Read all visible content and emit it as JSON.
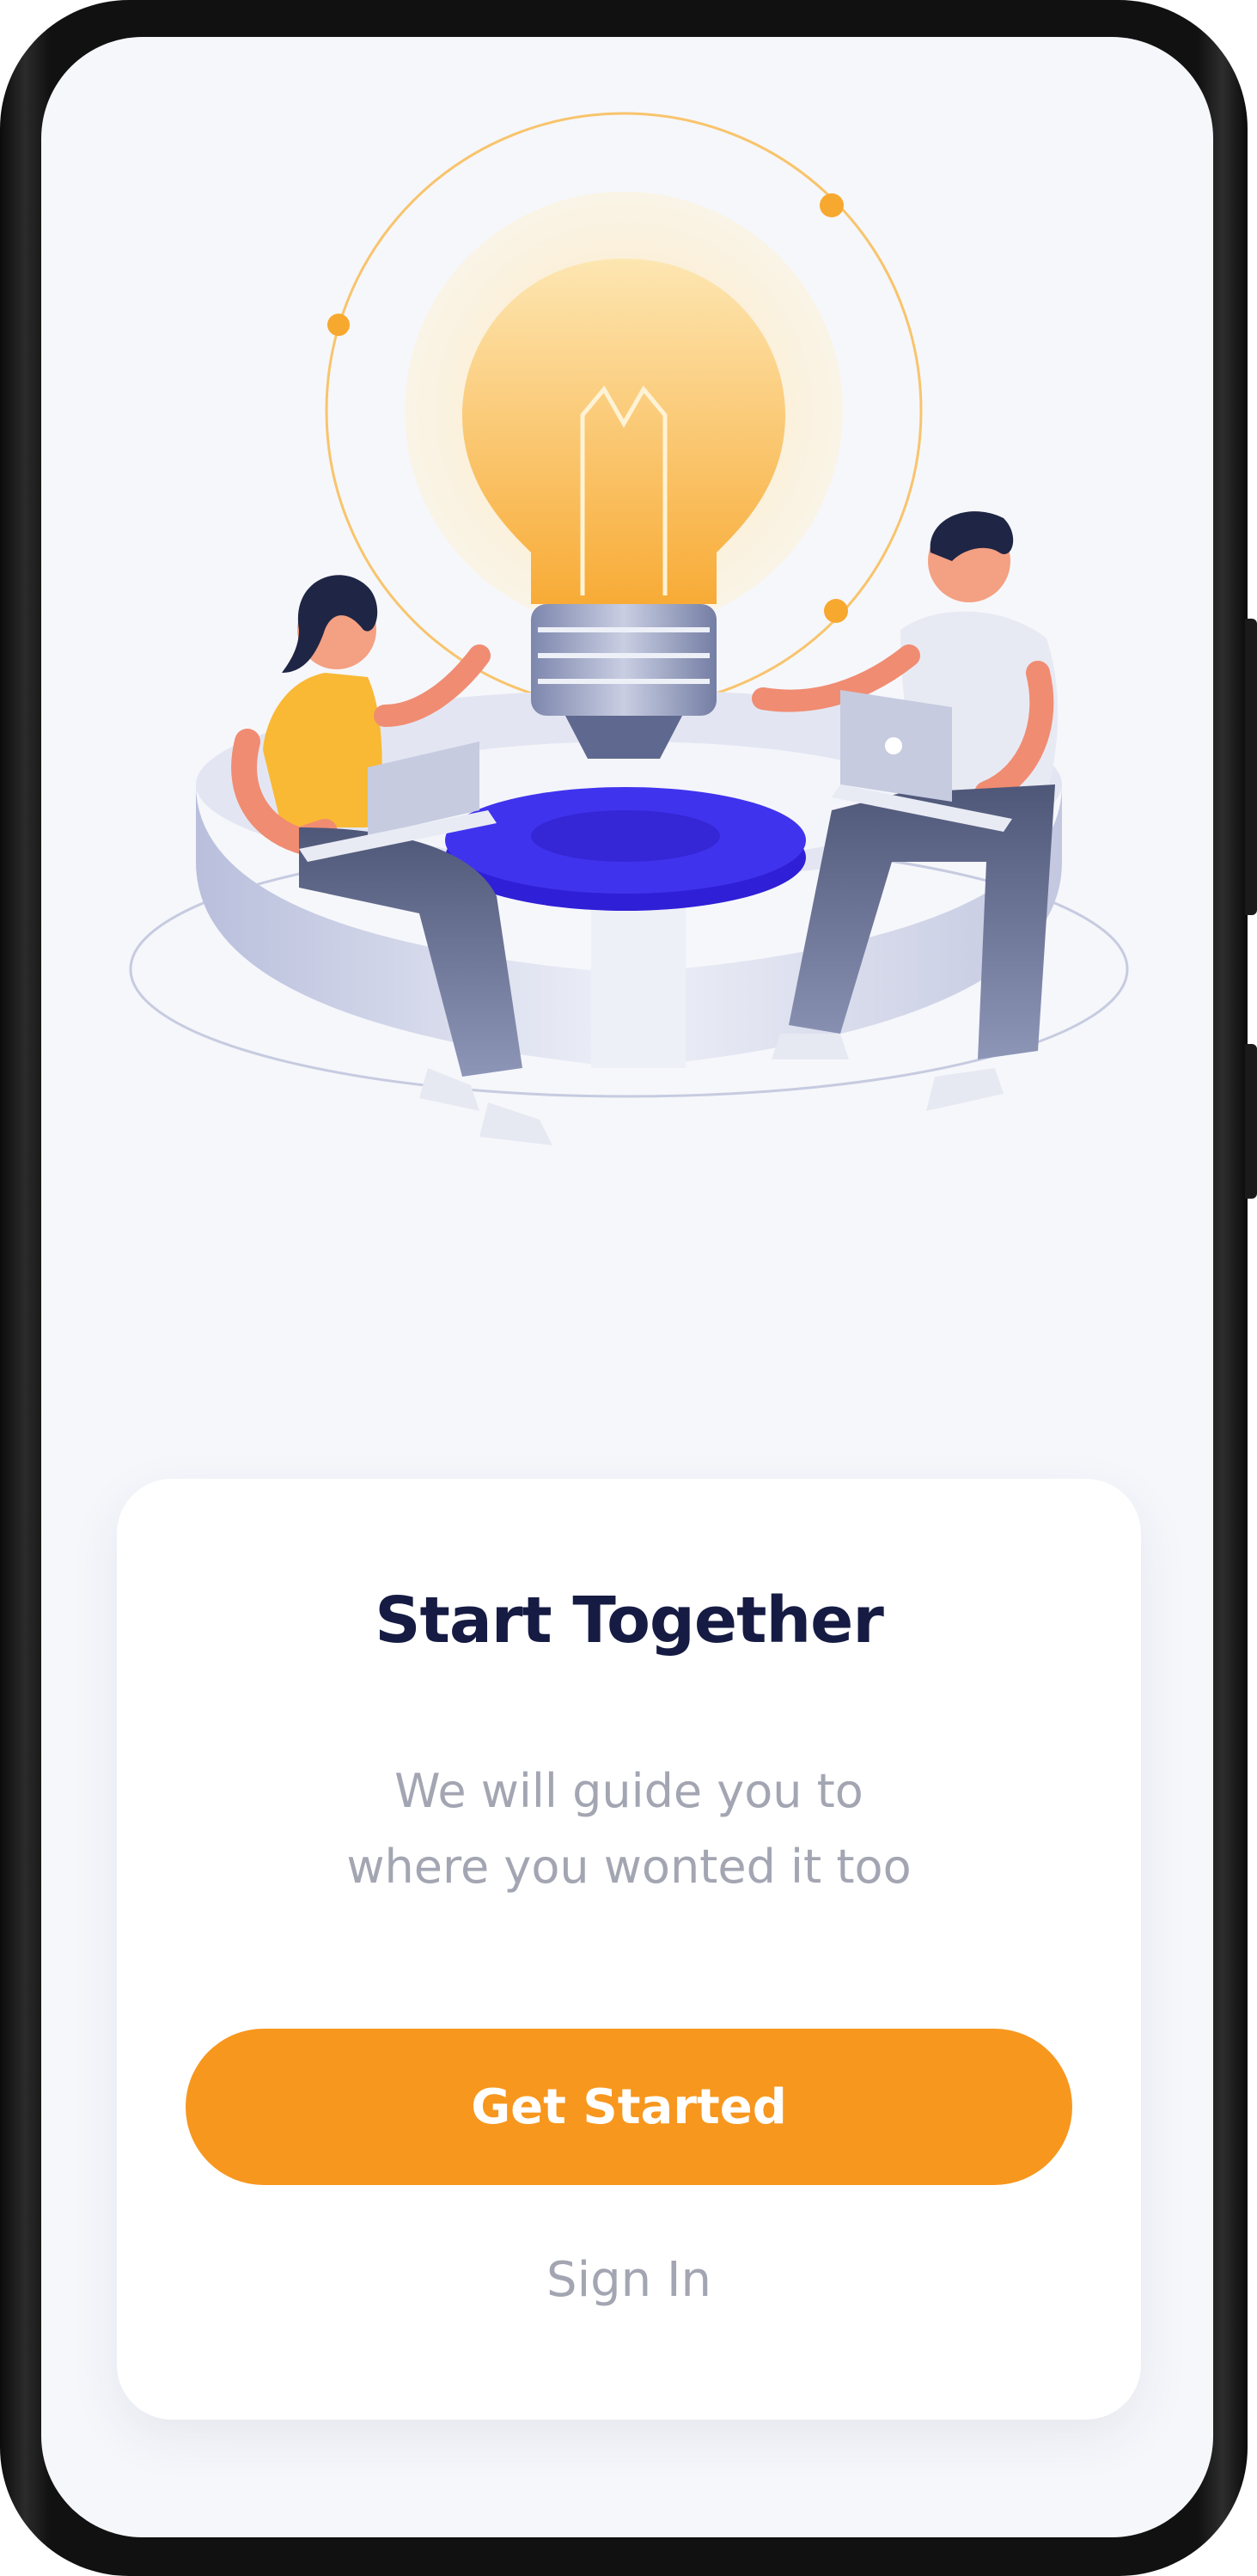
{
  "onboarding": {
    "title": "Start Together",
    "subtitle_line1": "We will guide you to",
    "subtitle_line2": "where you wonted it too",
    "primary_button_label": "Get Started",
    "secondary_link_label": "Sign In"
  },
  "illustration": {
    "name": "two-people-with-lightbulb-illustration"
  },
  "colors": {
    "accent": "#f7971e",
    "title": "#161b43",
    "muted_text": "#a3a6b2",
    "background": "#f6f7fb",
    "card": "#ffffff"
  }
}
